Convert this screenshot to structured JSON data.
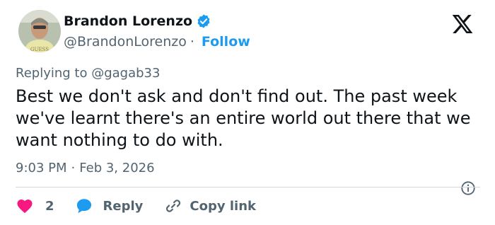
{
  "author": {
    "display_name": "Brandon Lorenzo",
    "handle": "@BrandonLorenzo",
    "separator": "·",
    "follow_label": "Follow",
    "avatar_caption": "GUESS"
  },
  "tweet": {
    "replying_prefix": "Replying to ",
    "replying_handle": "@gagab33",
    "text": "Best we don't ask and don't find out. The past week we've learnt there's an entire world out there that we want nothing to do with.",
    "time": "9:03 PM",
    "separator": "·",
    "date": "Feb 3, 2026"
  },
  "actions": {
    "like_count": "2",
    "reply_label": "Reply",
    "copy_label": "Copy link"
  },
  "colors": {
    "text": "#0f1419",
    "muted": "#536471",
    "accent": "#1d9bf0",
    "like": "#f91880",
    "divider": "#cfd9de"
  },
  "icons": [
    "avatar",
    "verified-badge-icon",
    "x-logo-icon",
    "info-icon",
    "heart-icon",
    "reply-bubble-icon",
    "link-icon"
  ]
}
